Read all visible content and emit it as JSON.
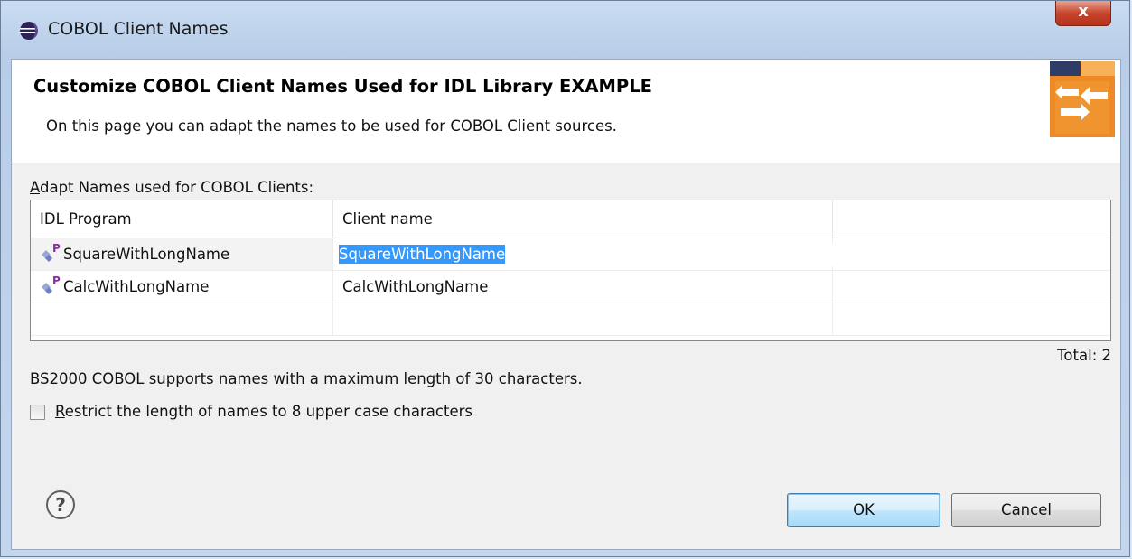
{
  "window": {
    "title": "COBOL Client Names",
    "close_label": "x"
  },
  "banner": {
    "title": "Customize COBOL Client Names Used for IDL Library EXAMPLE",
    "description": "On this page you can adapt the names to be used for COBOL Client sources."
  },
  "section": {
    "label_mnemonic": "A",
    "label_rest": "dapt Names used for COBOL Clients:"
  },
  "table": {
    "columns": [
      "IDL Program",
      "Client name",
      ""
    ],
    "rows": [
      {
        "program": "SquareWithLongName",
        "client_name": "SquareWithLongName",
        "editing": true
      },
      {
        "program": "CalcWithLongName",
        "client_name": "CalcWithLongName",
        "editing": false
      }
    ],
    "total": "Total: 2"
  },
  "info_text": "BS2000 COBOL supports names with a maximum length of 30 characters.",
  "restrict_checkbox": {
    "label_mnemonic": "R",
    "label_rest": "estrict the length of names to 8 upper case characters",
    "checked": false
  },
  "buttons": {
    "ok": "OK",
    "cancel": "Cancel"
  },
  "colors": {
    "selection": "#3399ff",
    "banner_image": "#f0922b"
  }
}
